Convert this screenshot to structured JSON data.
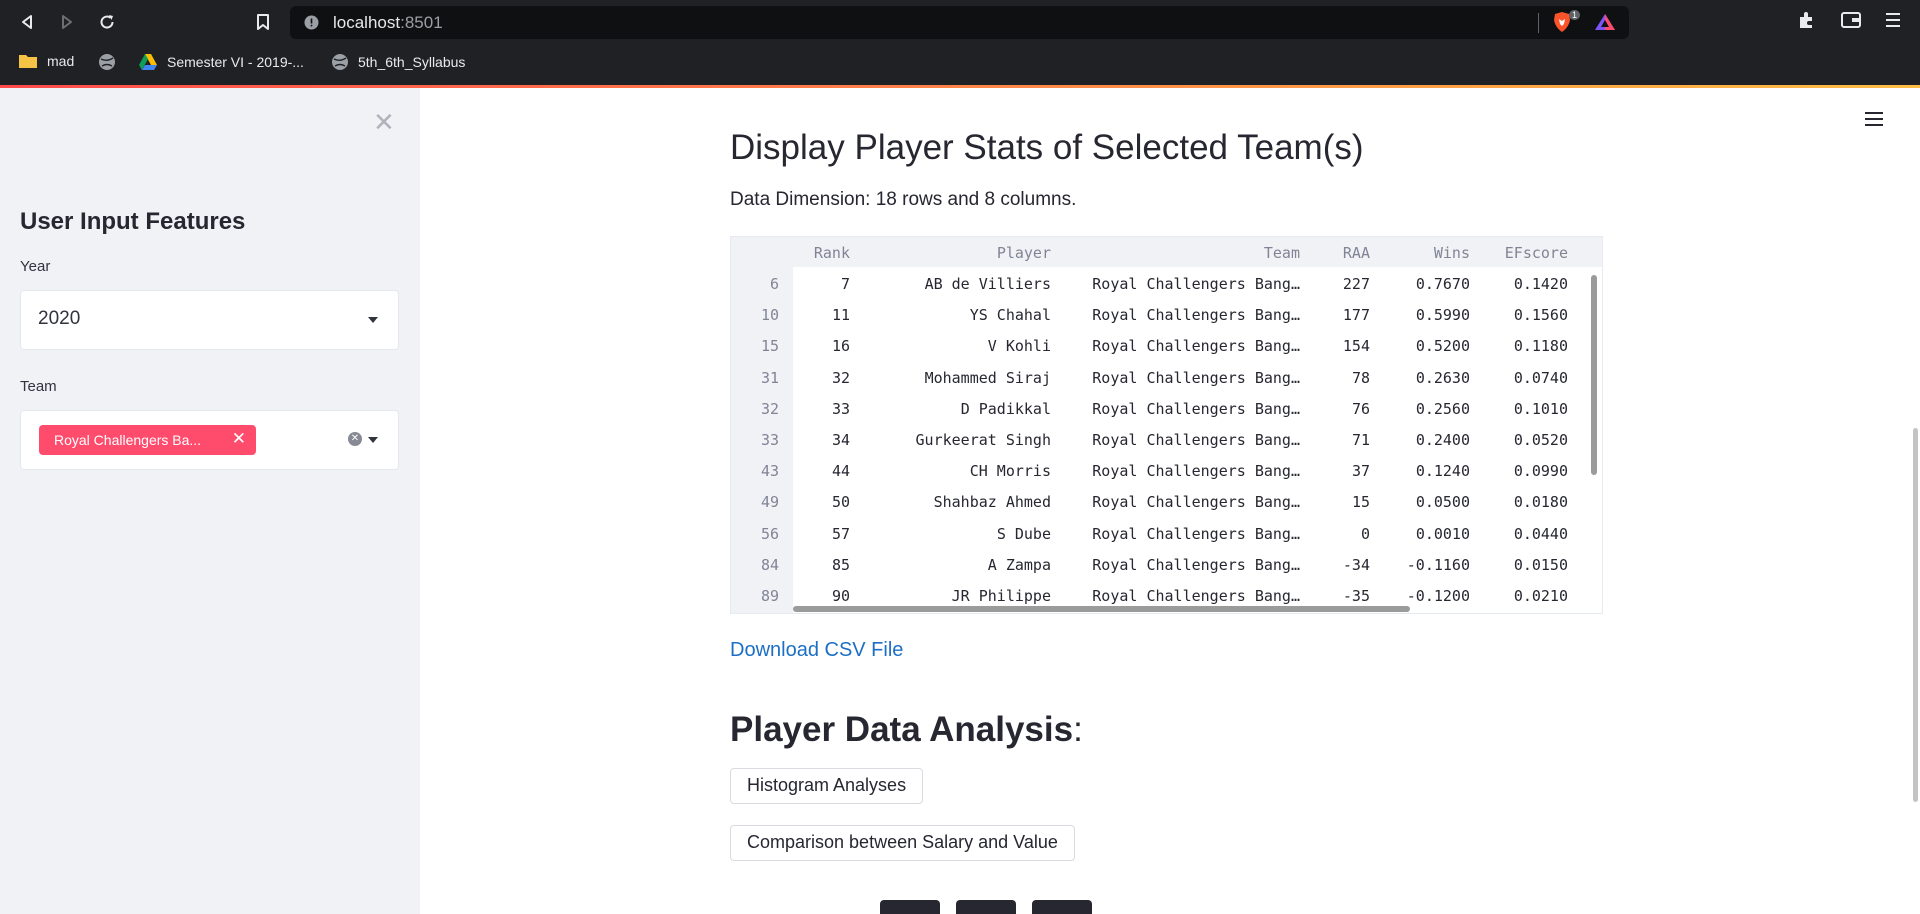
{
  "browser": {
    "url_host": "localhost",
    "url_port": ":8501",
    "shields_count": "1",
    "bookmarks": [
      {
        "label": "mad",
        "icon": "folder-icon"
      },
      {
        "label": "",
        "icon": "globe-icon"
      },
      {
        "label": "Semester VI - 2019-...",
        "icon": "drive-icon"
      },
      {
        "label": "5th_6th_Syllabus",
        "icon": "globe-icon"
      }
    ]
  },
  "sidebar": {
    "title": "User Input Features",
    "year_label": "Year",
    "year_value": "2020",
    "team_label": "Team",
    "team_tag": "Royal Challengers Ba..."
  },
  "main": {
    "section_title": "Display Player Stats of Selected Team(s)",
    "dimension_text": "Data Dimension: 18 rows and 8 columns.",
    "download_link": "Download CSV File",
    "analysis_title": "Player Data Analysis",
    "analysis_colon": ":",
    "buttons": [
      "Histogram Analyses",
      "Comparison between Salary and Value"
    ]
  },
  "table": {
    "columns": [
      "",
      "Rank",
      "Player",
      "Team",
      "RAA",
      "Wins",
      "EFscore"
    ],
    "rows": [
      [
        "6",
        "7",
        "AB de Villiers",
        "Royal Challengers Bang…",
        "227",
        "0.7670",
        "0.1420"
      ],
      [
        "10",
        "11",
        "YS Chahal",
        "Royal Challengers Bang…",
        "177",
        "0.5990",
        "0.1560"
      ],
      [
        "15",
        "16",
        "V Kohli",
        "Royal Challengers Bang…",
        "154",
        "0.5200",
        "0.1180"
      ],
      [
        "31",
        "32",
        "Mohammed Siraj",
        "Royal Challengers Bang…",
        "78",
        "0.2630",
        "0.0740"
      ],
      [
        "32",
        "33",
        "D Padikkal",
        "Royal Challengers Bang…",
        "76",
        "0.2560",
        "0.1010"
      ],
      [
        "33",
        "34",
        "Gurkeerat Singh",
        "Royal Challengers Bang…",
        "71",
        "0.2400",
        "0.0520"
      ],
      [
        "43",
        "44",
        "CH Morris",
        "Royal Challengers Bang…",
        "37",
        "0.1240",
        "0.0990"
      ],
      [
        "49",
        "50",
        "Shahbaz Ahmed",
        "Royal Challengers Bang…",
        "15",
        "0.0500",
        "0.0180"
      ],
      [
        "56",
        "57",
        "S Dube",
        "Royal Challengers Bang…",
        "0",
        "0.0010",
        "0.0440"
      ],
      [
        "84",
        "85",
        "A Zampa",
        "Royal Challengers Bang…",
        "-34",
        "-0.1160",
        "0.0150"
      ],
      [
        "89",
        "90",
        "JR Philippe",
        "Royal Challengers Bang…",
        "-35",
        "-0.1200",
        "0.0210"
      ]
    ]
  },
  "colors": {
    "primary": "#ff4b4b",
    "tag": "#ff4b6c",
    "link": "#1c6fc4",
    "sidebar_bg": "#f0f2f6"
  }
}
